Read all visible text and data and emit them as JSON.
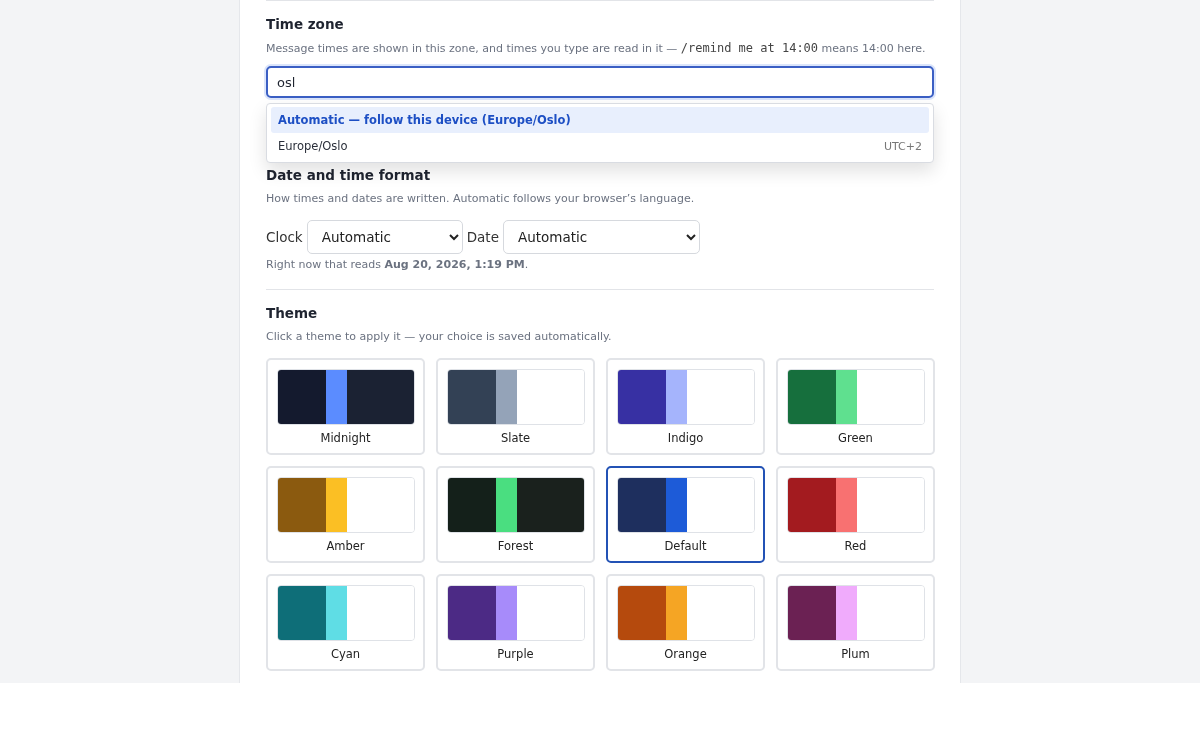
{
  "time_zone": {
    "title": "Time zone",
    "description": "Message times are shown in this zone, and times you type are read in it — ",
    "command": "/remind me at 14:00",
    "description_end": " means 14:00 here.",
    "search": {
      "value": "osl"
    },
    "suggestions": [
      {
        "label": "Automatic — follow this device (Europe/Oslo)",
        "selected": true
      },
      {
        "label": "Europe/Oslo",
        "offset": "UTC+2",
        "selected": false
      }
    ]
  },
  "date_time_format": {
    "title": "Date and time format",
    "description": "How times and dates are written. Automatic follows your browser’s language.",
    "clock_label": "Clock",
    "clock_value": "Automatic",
    "date_label": "Date",
    "date_value": "Automatic",
    "preview": "Right now that reads **Aug 20, 2026, 1:19 PM**."
  },
  "theme": {
    "title": "Theme",
    "description": "Click a theme to apply it — your choice is saved automatically.",
    "themes": [
      {
        "name": "Midnight",
        "swatch": [
          {
            "color": "#141a2e"
          },
          {
            "color": "#5b8cff"
          },
          {
            "color": "#1b2233"
          }
        ],
        "selected": false
      },
      {
        "name": "Slate",
        "swatch": [
          {
            "color": "#334155"
          },
          {
            "color": "#94a3b8"
          },
          {
            "color": "#ffffff"
          }
        ],
        "selected": false
      },
      {
        "name": "Indigo",
        "swatch": [
          {
            "color": "#3730a3"
          },
          {
            "color": "#a5b4fc"
          },
          {
            "color": "#ffffff"
          }
        ],
        "selected": false
      },
      {
        "name": "Green",
        "swatch": [
          {
            "color": "#166f3d"
          },
          {
            "color": "#5fe08f"
          },
          {
            "color": "#ffffff"
          }
        ],
        "selected": false
      },
      {
        "name": "Amber",
        "swatch": [
          {
            "color": "#8b5a0f"
          },
          {
            "color": "#fbbf24"
          },
          {
            "color": "#ffffff"
          }
        ],
        "selected": false
      },
      {
        "name": "Forest",
        "swatch": [
          {
            "color": "#14201a"
          },
          {
            "color": "#4ade80"
          },
          {
            "color": "#1a211d"
          }
        ],
        "selected": false
      },
      {
        "name": "Default",
        "swatch": [
          {
            "color": "#1e2f5e"
          },
          {
            "color": "#1d5bd8"
          },
          {
            "color": "#ffffff"
          }
        ],
        "selected": true
      },
      {
        "name": "Red",
        "swatch": [
          {
            "color": "#a31b1f"
          },
          {
            "color": "#f87171"
          },
          {
            "color": "#ffffff"
          }
        ],
        "selected": false
      },
      {
        "name": "Cyan",
        "swatch": [
          {
            "color": "#0e6e78"
          },
          {
            "color": "#5fdde5"
          },
          {
            "color": "#ffffff"
          }
        ],
        "selected": false
      },
      {
        "name": "Purple",
        "swatch": [
          {
            "color": "#4c2a85"
          },
          {
            "color": "#a78bfa"
          },
          {
            "color": "#ffffff"
          }
        ],
        "selected": false
      },
      {
        "name": "Orange",
        "swatch": [
          {
            "color": "#b54a0d"
          },
          {
            "color": "#f5a524"
          },
          {
            "color": "#ffffff"
          }
        ],
        "selected": false
      },
      {
        "name": "Plum",
        "swatch": [
          {
            "color": "#6b2153"
          },
          {
            "color": "#f0abfc"
          },
          {
            "color": "#ffffff"
          }
        ],
        "selected": false
      }
    ]
  }
}
